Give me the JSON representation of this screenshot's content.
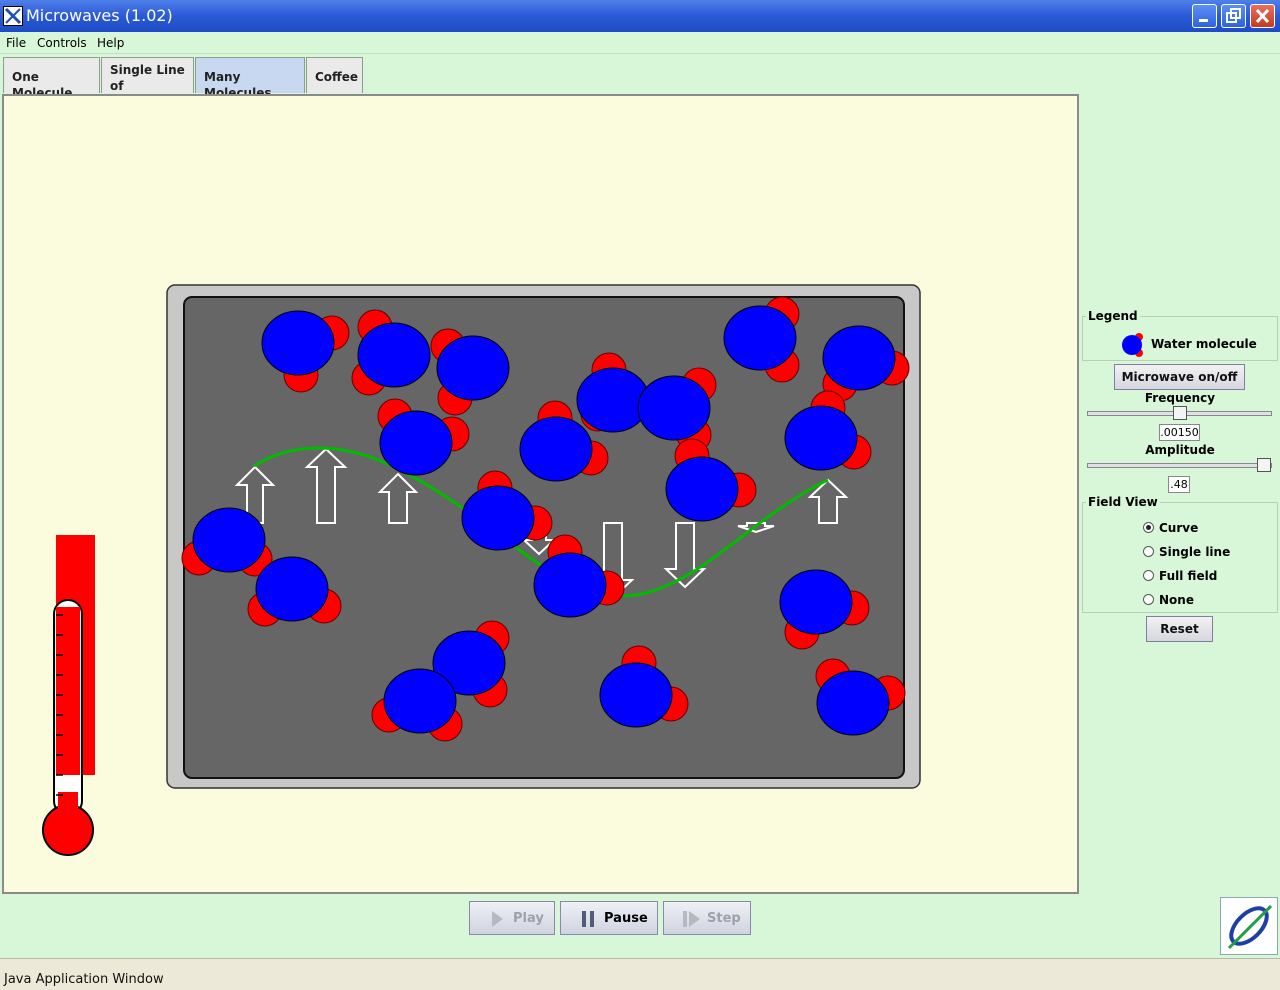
{
  "window": {
    "title": "Microwaves (1.02)"
  },
  "menu": [
    "File",
    "Controls",
    "Help"
  ],
  "tabs": [
    {
      "line1": "One Molecule",
      "line2": ""
    },
    {
      "line1": "Single Line",
      "line2": "of Molecules"
    },
    {
      "line1": "Many Molecules",
      "line2": ""
    },
    {
      "line1": "Coffee",
      "line2": ""
    }
  ],
  "panel": {
    "legend_title": "Legend",
    "legend_item": "Water molecule",
    "microwave_button": "Microwave on/off",
    "frequency_label": "Frequency",
    "frequency_value": ".00150",
    "amplitude_label": "Amplitude",
    "amplitude_value": ".48",
    "field_view_title": "Field View",
    "field_options": [
      "Curve",
      "Single line",
      "Full field",
      "None"
    ],
    "field_selected": "Curve",
    "reset_button": "Reset"
  },
  "controls": {
    "play": "Play",
    "pause": "Pause",
    "step": "Step"
  },
  "status": {
    "text": "Java Application Window"
  },
  "colors": {
    "molecule": "#0000ff",
    "hydrogen": "#ff0000",
    "curve": "#00bb00",
    "oven": "#666666",
    "background": "#fbfbde"
  }
}
